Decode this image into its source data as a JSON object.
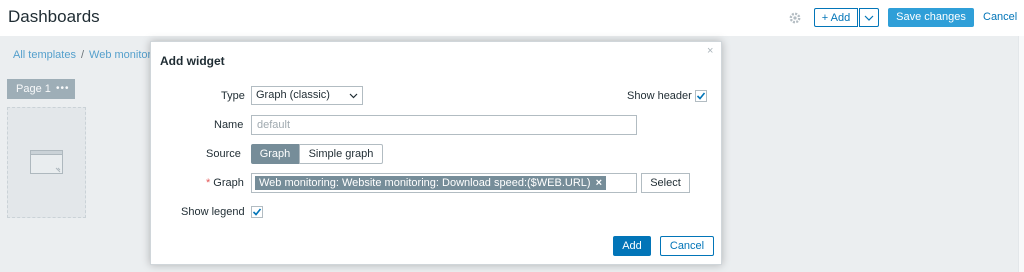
{
  "header": {
    "title": "Dashboards",
    "gear_icon": "gear-icon",
    "add_label": "+ Add",
    "save_label": "Save changes",
    "cancel_label": "Cancel"
  },
  "breadcrumb": {
    "items": [
      "All templates",
      "Web monitori"
    ],
    "separator": "/"
  },
  "pages": {
    "tab_label": "Page 1",
    "tab_menu": "•••"
  },
  "modal": {
    "title": "Add widget",
    "close": "×",
    "type_label": "Type",
    "type_value": "Graph (classic)",
    "show_header_label": "Show header",
    "show_header_checked": true,
    "name_label": "Name",
    "name_placeholder": "default",
    "source_label": "Source",
    "source_options": [
      "Graph",
      "Simple graph"
    ],
    "source_selected": "Graph",
    "graph_required": "*",
    "graph_label": "Graph",
    "graph_selected": "Web monitoring: Website monitoring: Download speed:($WEB.URL)",
    "graph_remove": "×",
    "select_label": "Select",
    "show_legend_label": "Show legend",
    "show_legend_checked": true,
    "add_label": "Add",
    "cancel_label": "Cancel"
  },
  "colors": {
    "primary": "#0275b8",
    "save": "#2f9fd8",
    "chip": "#768d99",
    "required": "#e45959"
  }
}
